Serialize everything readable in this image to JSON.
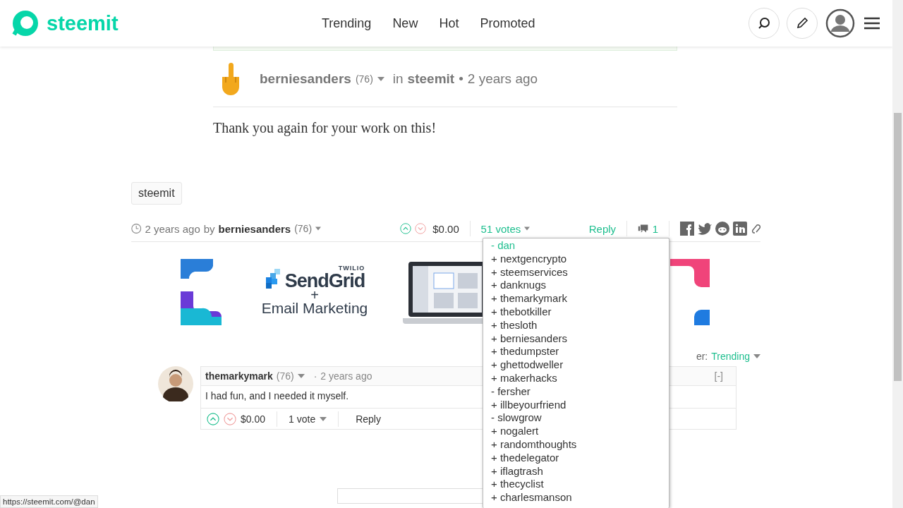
{
  "header": {
    "logo_text": "steemit",
    "nav": [
      {
        "label": "Trending"
      },
      {
        "label": "New"
      },
      {
        "label": "Hot"
      },
      {
        "label": "Promoted"
      }
    ]
  },
  "post": {
    "author": "berniesanders",
    "reputation": "(76)",
    "in_label": "in",
    "category": "steemit",
    "bullet": "•",
    "time": "2 years ago",
    "body": "Thank you again for your work on this!",
    "tags": [
      "steemit"
    ],
    "footer": {
      "time": "2 years ago",
      "by_label": "by",
      "author": "berniesanders",
      "reputation": "(76)",
      "payout": "$0.00",
      "votes": "51 votes",
      "reply": "Reply",
      "comment_count": "1"
    }
  },
  "ad": {
    "brand_small": "TWILIO",
    "brand": "SendGrid",
    "plus": "+",
    "tagline": "Email Marketing"
  },
  "sort": {
    "label": "er:",
    "value": "Trending"
  },
  "comments": [
    {
      "author": "themarkymark",
      "reputation": "(76)",
      "dot": "·",
      "time": "2 years ago",
      "collapse": "[-]",
      "body": "I had fun, and I needed it myself.",
      "payout": "$0.00",
      "votes": "1 vote",
      "reply": "Reply"
    }
  ],
  "voters": [
    {
      "label": "- dan",
      "hovered": true
    },
    {
      "label": "+ nextgencrypto",
      "hovered": false
    },
    {
      "label": "+ steemservices",
      "hovered": false
    },
    {
      "label": "+ danknugs",
      "hovered": false
    },
    {
      "label": "+ themarkymark",
      "hovered": false
    },
    {
      "label": "+ thebotkiller",
      "hovered": false
    },
    {
      "label": "+ thesloth",
      "hovered": false
    },
    {
      "label": "+ berniesanders",
      "hovered": false
    },
    {
      "label": "+ thedumpster",
      "hovered": false
    },
    {
      "label": "+ ghettodweller",
      "hovered": false
    },
    {
      "label": "+ makerhacks",
      "hovered": false
    },
    {
      "label": "- fersher",
      "hovered": false
    },
    {
      "label": "+ illbeyourfriend",
      "hovered": false
    },
    {
      "label": "- slowgrow",
      "hovered": false
    },
    {
      "label": "+ nogalert",
      "hovered": false
    },
    {
      "label": "+ randomthoughts",
      "hovered": false
    },
    {
      "label": "+ thedelegator",
      "hovered": false
    },
    {
      "label": "+ iflagtrash",
      "hovered": false
    },
    {
      "label": "+ thecyclist",
      "hovered": false
    },
    {
      "label": "+ charlesmanson",
      "hovered": false
    }
  ],
  "status_bar": {
    "url": "https://steemit.com/@dan"
  }
}
